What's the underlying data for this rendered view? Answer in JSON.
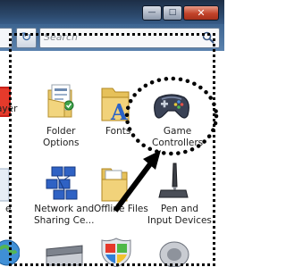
{
  "window": {
    "minimize_glyph": "—",
    "maximize_glyph": "□",
    "close_glyph": "✕"
  },
  "navbar": {
    "refresh_glyph": "↻",
    "search_placeholder": "Search",
    "search_icon": "magnifier-icon"
  },
  "items": [
    {
      "label": "ayer",
      "icon": "media-player-icon"
    },
    {
      "label_line1": "Folder",
      "label_line2": "Options",
      "icon": "folder-options-icon"
    },
    {
      "label": "Fonts",
      "icon": "fonts-folder-icon"
    },
    {
      "label_line1": "Game",
      "label_line2": "Controllers",
      "icon": "gamepad-icon"
    },
    {
      "label": "e",
      "icon": "partial-icon"
    },
    {
      "label_line1": "Network and",
      "label_line2": "Sharing Ce...",
      "icon": "network-icon"
    },
    {
      "label": "Offline Files",
      "icon": "offline-files-icon"
    },
    {
      "label_line1": "Pen and",
      "label_line2": "Input Devices",
      "icon": "pen-tablet-icon"
    }
  ],
  "bottom_row_icons": [
    "globe-icon",
    "scanner-icon",
    "shield-icon",
    "speaker-icon"
  ],
  "annotation": {
    "arrow_color": "#000000"
  }
}
